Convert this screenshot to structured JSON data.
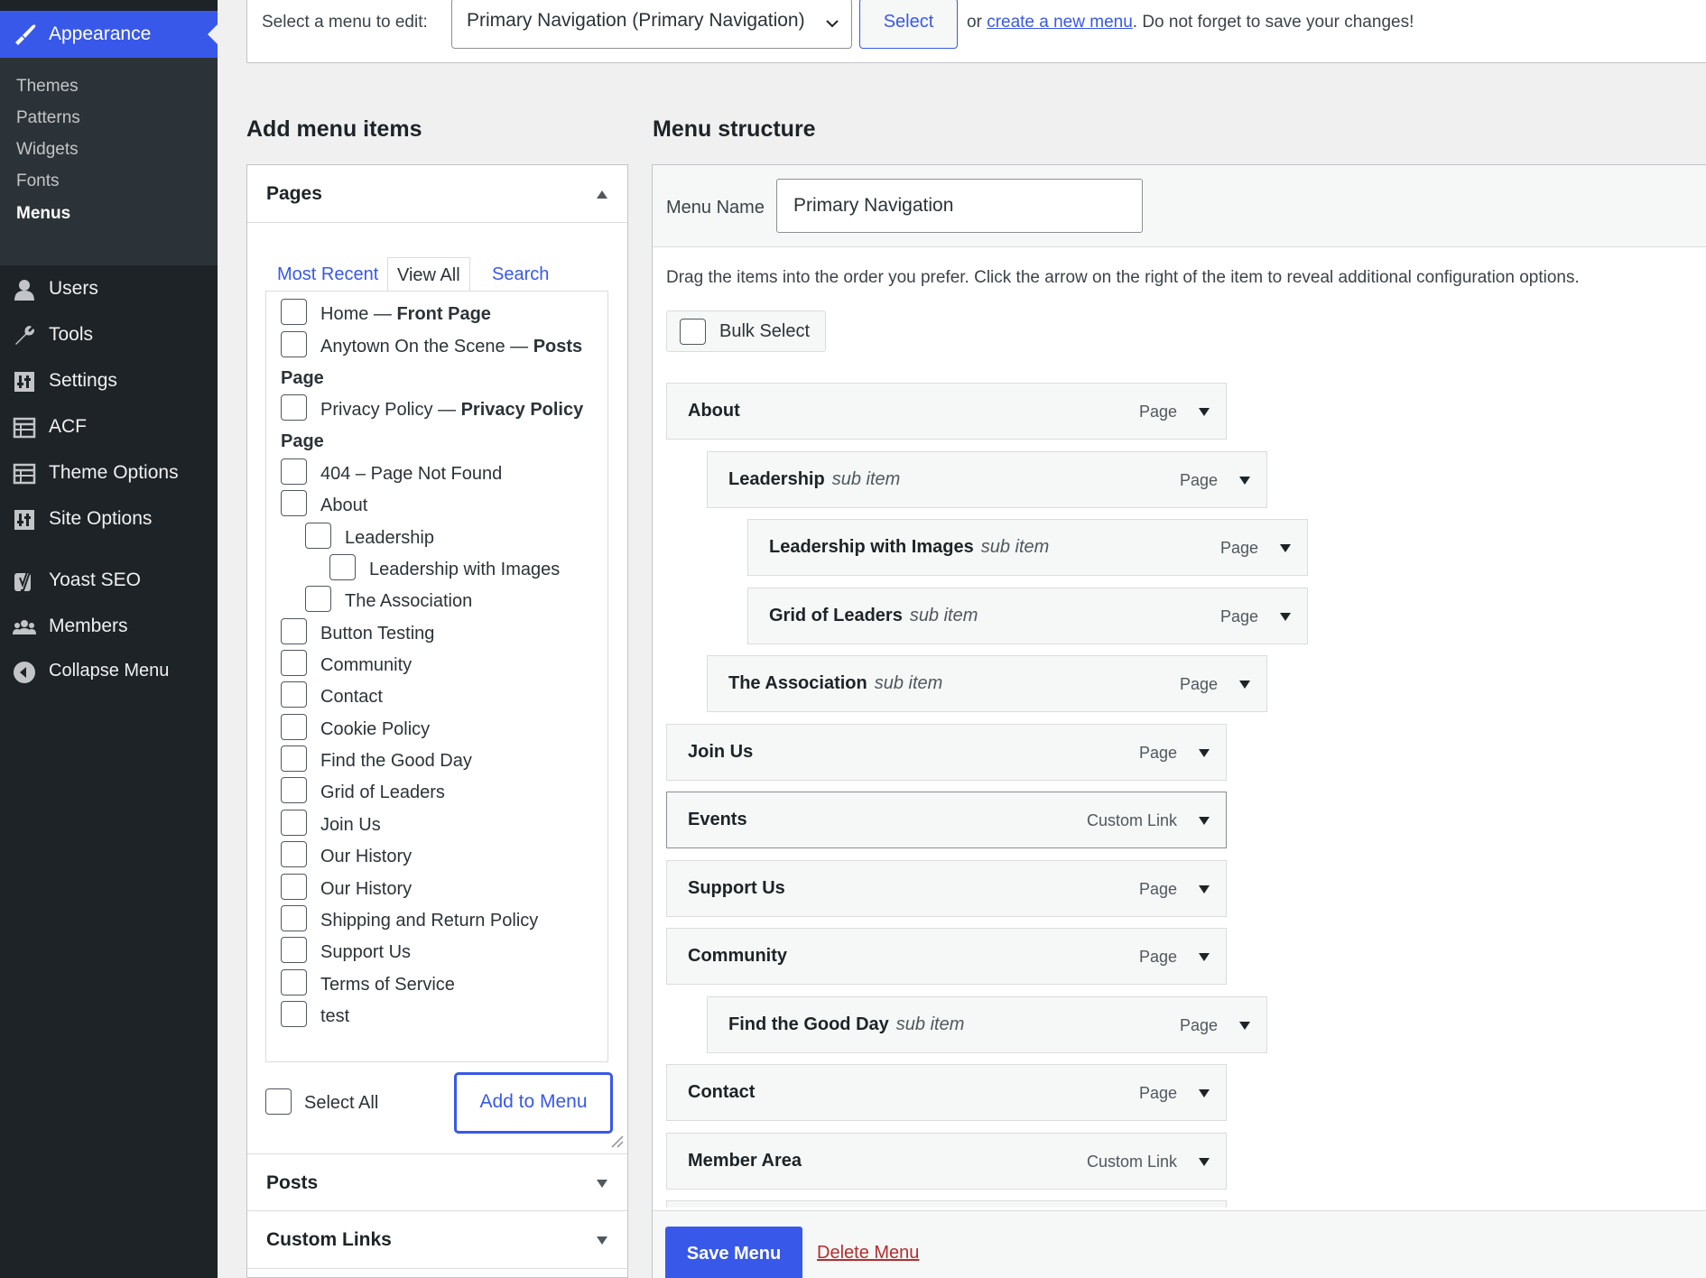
{
  "sidebar": {
    "current": {
      "label": "Appearance",
      "icon": "paintbrush-icon"
    },
    "submenu": [
      {
        "label": "Themes"
      },
      {
        "label": "Patterns"
      },
      {
        "label": "Widgets"
      },
      {
        "label": "Fonts"
      },
      {
        "label": "Menus",
        "active": true
      }
    ],
    "items": [
      {
        "label": "Users",
        "icon": "users-icon"
      },
      {
        "label": "Tools",
        "icon": "wrench-icon"
      },
      {
        "label": "Settings",
        "icon": "settings-icon"
      },
      {
        "label": "ACF",
        "icon": "grid-icon"
      },
      {
        "label": "Theme Options",
        "icon": "grid-icon"
      },
      {
        "label": "Site Options",
        "icon": "settings-icon"
      },
      {
        "label": "Yoast SEO",
        "icon": "yoast-icon"
      },
      {
        "label": "Members",
        "icon": "members-icon"
      },
      {
        "label": "Collapse Menu",
        "icon": "collapse-icon"
      }
    ]
  },
  "topbar": {
    "select_label": "Select a menu to edit:",
    "selected_menu": "Primary Navigation (Primary Navigation)",
    "select_button": "Select",
    "msg_prefix": "or ",
    "create_link": "create a new menu",
    "msg_suffix": ". Do not forget to save your changes!"
  },
  "add_menu_items": {
    "heading": "Add menu items",
    "pages_title": "Pages",
    "tabs": [
      "Most Recent",
      "View All",
      "Search"
    ],
    "pages": [
      {
        "text": "Home — ",
        "bold": "Front Page"
      },
      {
        "text": "Anytown On the Scene — ",
        "bold": "Posts",
        "bold2": "Page"
      },
      {
        "text": "Privacy Policy — ",
        "bold": "Privacy Policy",
        "bold2": "Page"
      },
      {
        "text": "404 – Page Not Found"
      },
      {
        "text": "About"
      },
      {
        "text": "Leadership"
      },
      {
        "text": "Leadership with Images"
      },
      {
        "text": "The Association"
      },
      {
        "text": "Button Testing"
      },
      {
        "text": "Community"
      },
      {
        "text": "Contact"
      },
      {
        "text": "Cookie Policy"
      },
      {
        "text": "Find the Good Day"
      },
      {
        "text": "Grid of Leaders"
      },
      {
        "text": "Join Us"
      },
      {
        "text": "Our History"
      },
      {
        "text": "Our History"
      },
      {
        "text": "Shipping and Return Policy"
      },
      {
        "text": "Support Us"
      },
      {
        "text": "Terms of Service"
      },
      {
        "text": "test"
      }
    ],
    "select_all": "Select All",
    "add_button": "Add to Menu",
    "posts_title": "Posts",
    "custom_links_title": "Custom Links"
  },
  "menu_structure": {
    "heading": "Menu structure",
    "name_label": "Menu Name",
    "name_value": "Primary Navigation",
    "instructions": "Drag the items into the order you prefer. Click the arrow on the right of the item to reveal additional configuration options.",
    "bulk_select": "Bulk Select",
    "sub_item_label": "sub item",
    "items": [
      {
        "title": "About",
        "type": "Page",
        "sub": false
      },
      {
        "title": "Leadership",
        "type": "Page",
        "sub": true
      },
      {
        "title": "Leadership with Images",
        "type": "Page",
        "sub": true
      },
      {
        "title": "Grid of Leaders",
        "type": "Page",
        "sub": true
      },
      {
        "title": "The Association",
        "type": "Page",
        "sub": true
      },
      {
        "title": "Join Us",
        "type": "Page",
        "sub": false
      },
      {
        "title": "Events",
        "type": "Custom Link",
        "sub": false
      },
      {
        "title": "Support Us",
        "type": "Page",
        "sub": false
      },
      {
        "title": "Community",
        "type": "Page",
        "sub": false
      },
      {
        "title": "Find the Good Day",
        "type": "Page",
        "sub": true
      },
      {
        "title": "Contact",
        "type": "Page",
        "sub": false
      },
      {
        "title": "Member Area",
        "type": "Custom Link",
        "sub": false
      }
    ],
    "save_button": "Save Menu",
    "delete_link": "Delete Menu"
  },
  "colors": {
    "accent": "#3858e9",
    "sidebar_bg": "#1d2327",
    "delete": "#b32d2e"
  }
}
